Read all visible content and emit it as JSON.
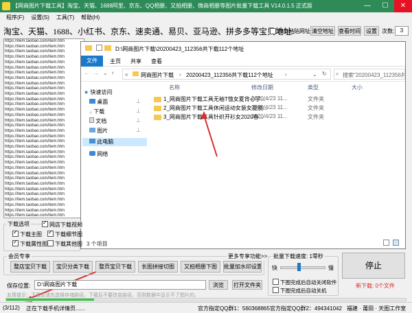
{
  "title": "【网商图片下载工具】淘宝、天猫、1688阿里、京东、QQ相册、又拍相册、微商相册等图片批量下载工具 V14.0.1.5 正式版",
  "window_buttons": {
    "min": "—",
    "max": "☐",
    "close": "✕"
  },
  "menu": [
    "程序(F)",
    "设置(S)",
    "工具(T)",
    "帮助(H)"
  ],
  "urlbar": {
    "label": "淘宝、天猫、1688、小红书、京东、速卖通、易贝、亚马逊、拼多多等宝贝地址:",
    "auto_paste": "自动粘贴网址",
    "clear_btn": "清空地址",
    "set_time_btn": "查看时间",
    "settings_btn": "设置",
    "count_label": "次数:",
    "count_value": "3"
  },
  "link_lines": [
    "https://item.taobao.com/item.htm",
    "https://item.taobao.com/item.htm",
    "https://item.taobao.com/item.htm",
    "https://item.taobao.com/item.htm",
    "https://item.taobao.com/item.htm",
    "https://item.taobao.com/item.htm",
    "https://item.taobao.com/item.htm",
    "https://item.taobao.com/item.htm",
    "https://item.taobao.com/item.htm",
    "https://item.taobao.com/item.htm",
    "https://item.taobao.com/item.htm",
    "https://item.taobao.com/item.htm",
    "https://item.taobao.com/item.htm",
    "https://item.taobao.com/item.htm",
    "https://item.taobao.com/item.htm",
    "https://item.taobao.com/item.htm",
    "https://item.taobao.com/item.htm",
    "https://item.taobao.com/item.htm",
    "https://item.taobao.com/item.htm",
    "https://item.taobao.com/item.htm",
    "https://item.taobao.com/item.htm",
    "https://item.taobao.com/item.htm",
    "https://item.taobao.com/item.htm",
    "https://item.taobao.com/item.htm",
    "https://item.taobao.com/item.htm",
    "https://item.taobao.com/item.htm",
    "https://item.taobao.com/item.htm",
    "https://item.taobao.com/item.htm",
    "https://item.taobao.com/item.htm",
    "https://item.taobao.com/item.htm",
    "https://item.taobao.com/item.htm",
    "https://item.taobao.com/item.htm",
    "https://item.taobao.com/item.htm",
    "https://item.taobao.com/item.htm"
  ],
  "explorer": {
    "title": "D:\\网商图片下载\\20200423_112356共下载112个地址",
    "ribbon_tabs": [
      "文件",
      "主页",
      "共享",
      "查看"
    ],
    "breadcrumb": [
      "«",
      "网商图片下载",
      "›",
      "20200423_112356共下载112个地址",
      "›"
    ],
    "search_placeholder": "搜索\"20200423_112356共下载...",
    "nav": [
      "快速访问",
      "桌面",
      "下载",
      "文档",
      "图片",
      "此电脑",
      "网络"
    ],
    "columns": [
      "名称",
      "修改日期",
      "类型",
      "大小"
    ],
    "files": [
      {
        "name": "1_网商图片下载工具无袖T恤女夏背心学...",
        "date": "2020/4/23 11...",
        "type": "文件夹"
      },
      {
        "name": "2_网商图片下载工具休闲运动女装女夏脱...",
        "date": "2020/4/23 11...",
        "type": "文件夹"
      },
      {
        "name": "3_网商图片下载工具针织开衫女2020春...",
        "date": "2020/4/23 11...",
        "type": "文件夹"
      }
    ],
    "status": "3 个项目"
  },
  "options": {
    "legend": "下载选项",
    "items": [
      {
        "label": "网店下载视频",
        "checked": true
      },
      {
        "label": "下载主图",
        "checked": true
      },
      {
        "label": "下载细节图",
        "checked": true
      },
      {
        "label": "下载属性图",
        "checked": true
      },
      {
        "label": "下载其他图",
        "checked": false
      }
    ]
  },
  "member": {
    "legend": "会员专享",
    "more": "更多专享功能>>",
    "buttons": [
      "整店宝贝下载",
      "宝贝分类下载",
      "整页宝贝下载",
      "长图拼接切图",
      "又拍相册下图",
      "批量加水印设置"
    ]
  },
  "save": {
    "label": "保存位置:",
    "path": "D:\\网商图片下载",
    "browse": "浏览",
    "open": "打开文件夹"
  },
  "tip": "友情提示：下载前请先选择存储路径，下载后不要改变路径，否则数据中显示不了图片的。",
  "batch": {
    "legend": "批量下载速度: 1零秒",
    "slow": "快",
    "fast": "慢",
    "speed": 0.4,
    "after1": "下图完成后自动关闭软件",
    "after2": "下图完成后自动关机"
  },
  "stop_label": "停止",
  "new_download": "新下载: 0个文件",
  "progress": 0.22,
  "statusbar": {
    "count": "(3/112)",
    "msg": "正在下载手机详情页......",
    "qq1": "官方指定QQ群1：560368865",
    "qq2": "官方指定QQ群2：494341042",
    "studio": "福建 · 莆田 · 天图工作室"
  },
  "colors": {
    "titlebar": "#2e8b57",
    "accent": "#1979ca",
    "progress": "#2ecc40",
    "annotation": "#d62d2d"
  }
}
